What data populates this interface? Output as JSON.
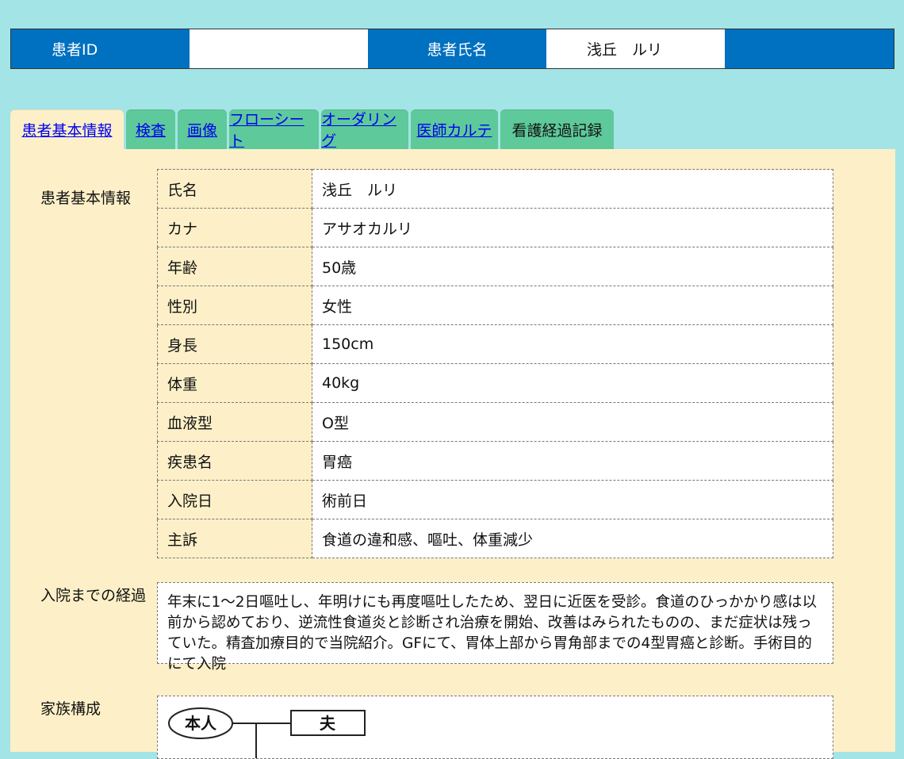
{
  "header": {
    "patient_id_label": "患者ID",
    "patient_id_value": "",
    "patient_name_label": "患者氏名",
    "patient_name_value": "浅丘　ルリ"
  },
  "tabs": [
    {
      "label": "患者基本情報",
      "active": true,
      "link": true
    },
    {
      "label": "検査",
      "active": false,
      "link": true
    },
    {
      "label": "画像",
      "active": false,
      "link": true
    },
    {
      "label": "フローシート",
      "active": false,
      "link": true
    },
    {
      "label": "オーダリング",
      "active": false,
      "link": true
    },
    {
      "label": "医師カルテ",
      "active": false,
      "link": true
    },
    {
      "label": "看護経過記録",
      "active": false,
      "link": false
    }
  ],
  "basic_info": {
    "section_label": "患者基本情報",
    "rows": [
      {
        "key": "氏名",
        "value": "浅丘　ルリ"
      },
      {
        "key": "カナ",
        "value": "アサオカルリ"
      },
      {
        "key": "年齢",
        "value": "50歳"
      },
      {
        "key": "性別",
        "value": "女性"
      },
      {
        "key": "身長",
        "value": "150cm"
      },
      {
        "key": "体重",
        "value": "40kg"
      },
      {
        "key": "血液型",
        "value": "O型"
      },
      {
        "key": "疾患名",
        "value": "胃癌"
      },
      {
        "key": "入院日",
        "value": "術前日"
      },
      {
        "key": "主訴",
        "value": "食道の違和感、嘔吐、体重減少"
      }
    ]
  },
  "course": {
    "section_label": "入院までの経過",
    "text": "年末に1～2日嘔吐し、年明けにも再度嘔吐したため、翌日に近医を受診。食道のひっかかり感は以前から認めており、逆流性食道炎と診断され治療を開始、改善はみられたものの、まだ症状は残っていた。精査加療目的で当院紹介。GFにて、胃体上部から胃角部までの4型胃癌と診断。手術目的にて入院"
  },
  "family": {
    "section_label": "家族構成",
    "self_label": "本人",
    "husband_label": "夫"
  },
  "colors": {
    "background": "#a3e4e6",
    "header_blue": "#0070c0",
    "tab_green": "#5ec99a",
    "panel_cream": "#fdf0c8"
  }
}
